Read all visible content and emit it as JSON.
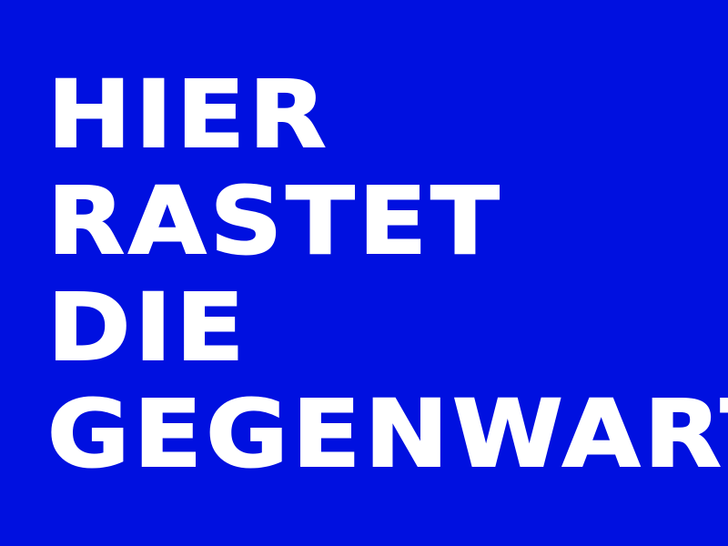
{
  "poster": {
    "lines": [
      "HIER",
      "RASTET",
      "DIE",
      "GEGENWART"
    ],
    "text_color": "#ffffff",
    "background_color": "#0010e0"
  }
}
